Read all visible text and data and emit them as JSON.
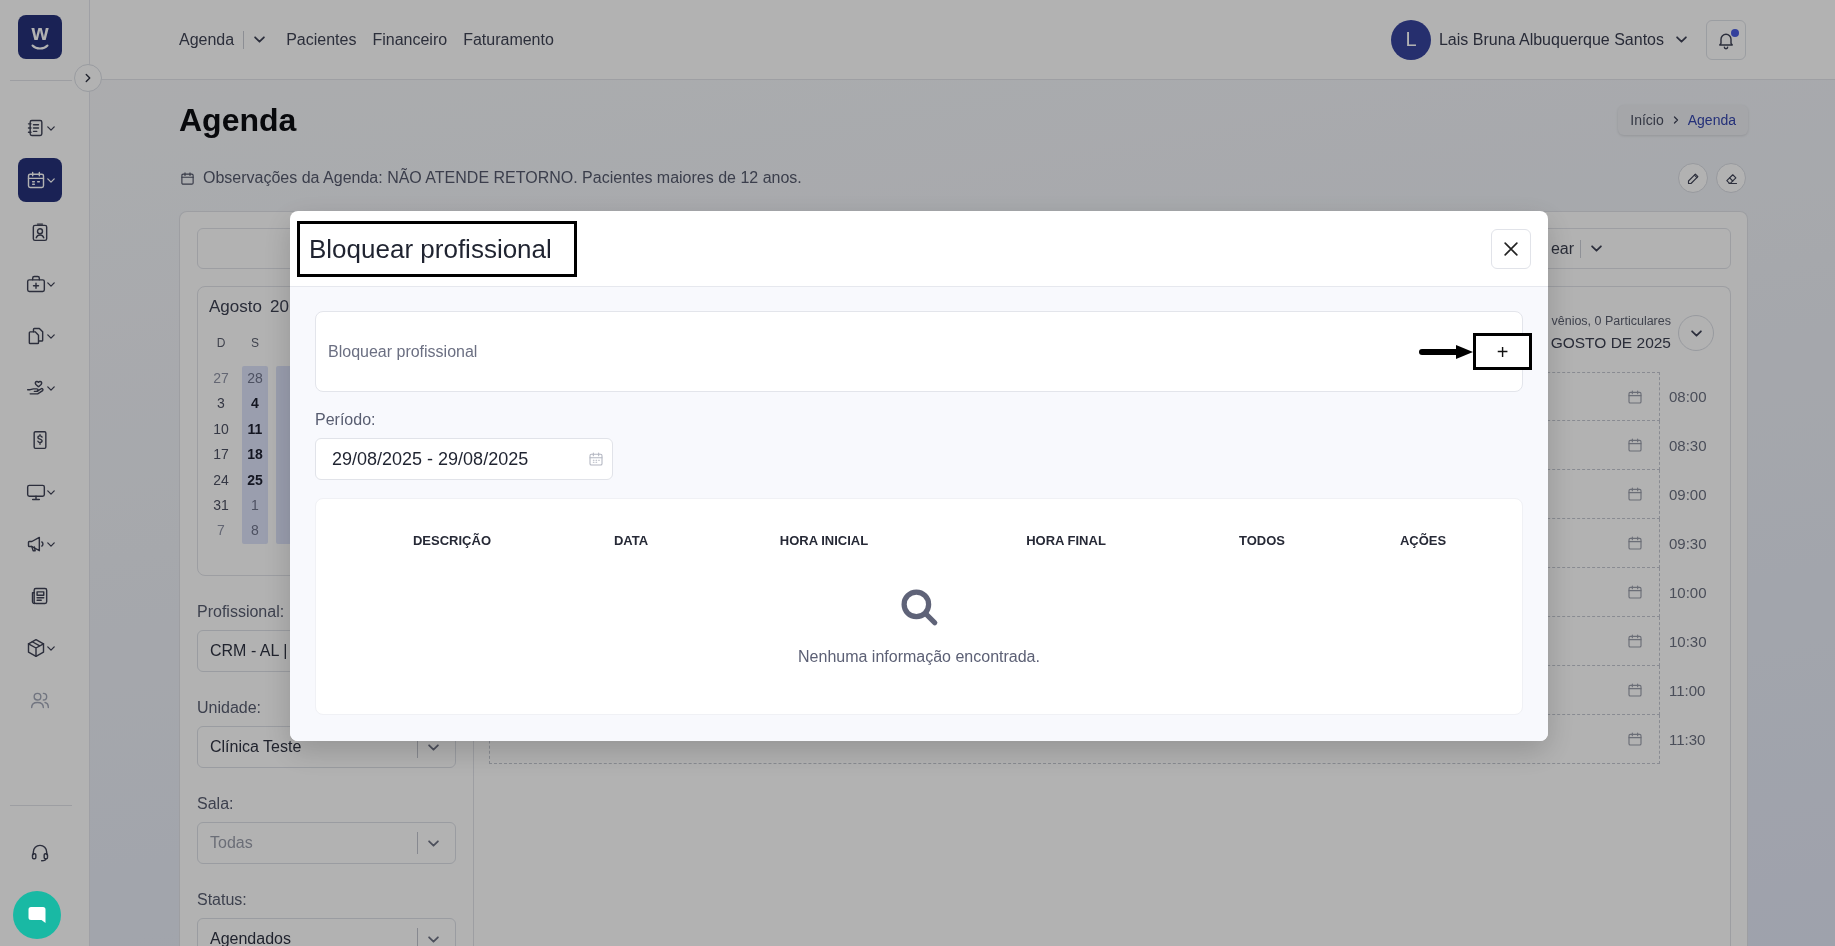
{
  "sidebar": {
    "logo": "w",
    "items": [
      {
        "selected": false,
        "submenu": true,
        "disabled": false
      },
      {
        "selected": true,
        "submenu": true,
        "disabled": false
      },
      {
        "selected": false,
        "submenu": false,
        "disabled": false
      },
      {
        "selected": false,
        "submenu": true,
        "disabled": false
      },
      {
        "selected": false,
        "submenu": true,
        "disabled": false
      },
      {
        "selected": false,
        "submenu": true,
        "disabled": false
      },
      {
        "selected": false,
        "submenu": false,
        "disabled": false
      },
      {
        "selected": false,
        "submenu": true,
        "disabled": false
      },
      {
        "selected": false,
        "submenu": true,
        "disabled": false
      },
      {
        "selected": false,
        "submenu": false,
        "disabled": false
      },
      {
        "selected": false,
        "submenu": true,
        "disabled": false
      },
      {
        "selected": false,
        "submenu": false,
        "disabled": true
      }
    ]
  },
  "header": {
    "nav": [
      {
        "label": "Agenda",
        "kind": "menu"
      },
      {
        "label": "Pacientes",
        "kind": "link"
      },
      {
        "label": "Financeiro",
        "kind": "link"
      },
      {
        "label": "Faturamento",
        "kind": "link"
      }
    ],
    "user": {
      "initial": "L",
      "name": "Lais Bruna Albuquerque Santos"
    },
    "notifications": {
      "unread": true
    }
  },
  "page": {
    "title": "Agenda",
    "breadcrumb": [
      {
        "label": "Início",
        "current": false
      },
      {
        "label": "Agenda",
        "current": true
      }
    ],
    "note": "Observações da Agenda: NÃO ATENDE RETORNO. Pacientes maiores de 12 anos."
  },
  "toolbar": {
    "action": "ear",
    "dropdown": true
  },
  "calendar": {
    "month": "Agosto",
    "year": "20",
    "columns": [
      {
        "label": "D",
        "highlighted": false,
        "days": [
          {
            "label": "27",
            "muted": true,
            "emphasized": false
          },
          {
            "label": "3",
            "muted": false,
            "emphasized": false
          },
          {
            "label": "10",
            "muted": false,
            "emphasized": false
          },
          {
            "label": "17",
            "muted": false,
            "emphasized": false
          },
          {
            "label": "24",
            "muted": false,
            "emphasized": false
          },
          {
            "label": "31",
            "muted": false,
            "emphasized": false
          },
          {
            "label": "7",
            "muted": true,
            "emphasized": false
          }
        ]
      },
      {
        "label": "S",
        "highlighted": true,
        "days": [
          {
            "label": "28",
            "muted": true,
            "emphasized": false
          },
          {
            "label": "4",
            "muted": false,
            "emphasized": true
          },
          {
            "label": "11",
            "muted": false,
            "emphasized": true
          },
          {
            "label": "18",
            "muted": false,
            "emphasized": true
          },
          {
            "label": "25",
            "muted": false,
            "emphasized": true
          },
          {
            "label": "1",
            "muted": true,
            "emphasized": false
          },
          {
            "label": "8",
            "muted": true,
            "emphasized": false
          }
        ]
      },
      {
        "highlighted": true
      }
    ]
  },
  "filters": [
    {
      "label": "Profissional:",
      "value": "CRM - AL |",
      "kind": "combobox"
    },
    {
      "label": "Unidade:",
      "value": "Clínica Teste",
      "kind": "select"
    },
    {
      "label": "Sala:",
      "placeholder": "Todas",
      "kind": "select"
    },
    {
      "label": "Status:",
      "value": "Agendados",
      "kind": "select"
    }
  ],
  "schedule": {
    "summary": "vênios, 0 Particulares",
    "date": "GOSTO DE 2025",
    "slots": [
      "08:00",
      "08:30",
      "09:00",
      "09:30",
      "10:00",
      "10:30",
      "11:00",
      "11:30"
    ]
  },
  "modal": {
    "title": "Bloquear profissional",
    "add_row": {
      "label": "Bloquear profissional",
      "button": "+"
    },
    "period": {
      "label": "Período:",
      "value": "29/08/2025 - 29/08/2025"
    },
    "table": {
      "columns": [
        "DESCRIÇÃO",
        "DATA",
        "HORA INICIAL",
        "HORA FINAL",
        "TODOS",
        "AÇÕES"
      ],
      "empty_message": "Nenhuma informação encontrada."
    },
    "annotations": {
      "title_frame": true,
      "button_frame": true,
      "arrow": true
    }
  }
}
